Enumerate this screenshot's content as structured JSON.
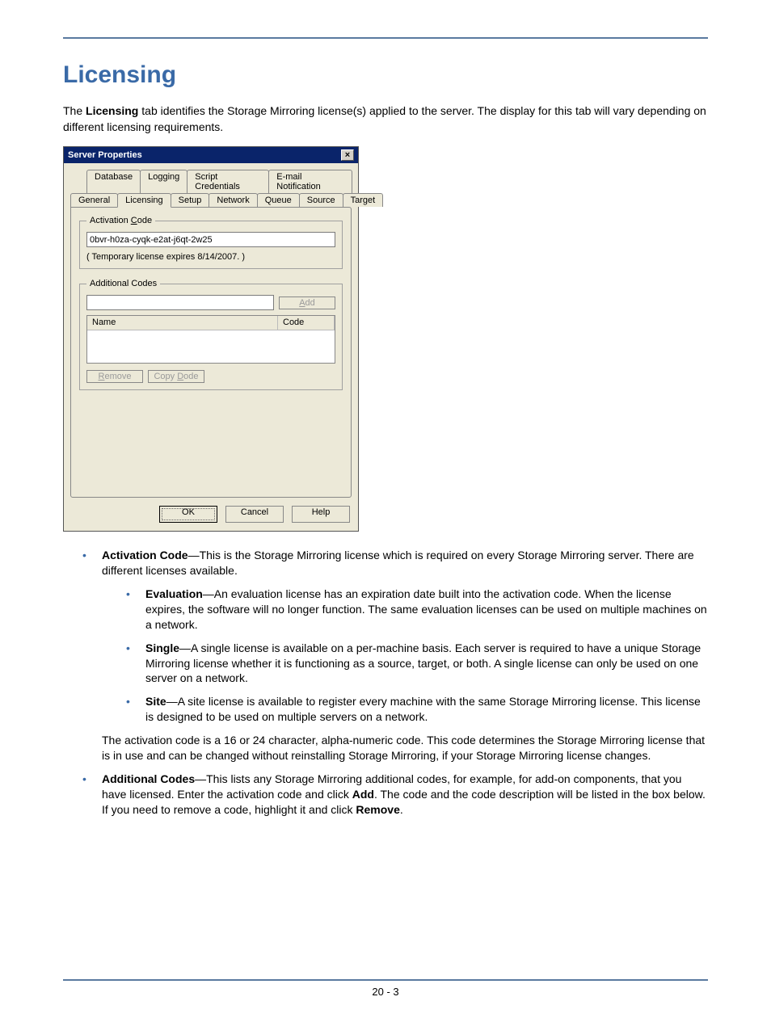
{
  "heading": "Licensing",
  "intro_pre": "The ",
  "intro_bold": "Licensing",
  "intro_post": " tab identifies the Storage Mirroring license(s) applied to the server. The display for this tab will vary depending on different licensing requirements.",
  "dialog": {
    "title": "Server Properties",
    "close": "×",
    "tabs_row1": [
      "Database",
      "Logging",
      "Script Credentials",
      "E-mail Notification"
    ],
    "tabs_row2": [
      "General",
      "Licensing",
      "Setup",
      "Network",
      "Queue",
      "Source",
      "Target"
    ],
    "activation": {
      "legend_pre": "Activation ",
      "legend_key": "C",
      "legend_post": "ode",
      "value": "0bvr-h0za-cyqk-e2at-j6qt-2w25",
      "hint": "( Temporary license expires 8/14/2007. )"
    },
    "additional": {
      "legend": "Additional Codes",
      "add_label_key": "A",
      "add_label_rest": "dd",
      "col_name": "Name",
      "col_code": "Code",
      "remove_key": "R",
      "remove_rest": "emove",
      "copy_pre": "Copy ",
      "copy_key": "D",
      "copy_rest": "ode"
    },
    "buttons": {
      "ok": "OK",
      "cancel": "Cancel",
      "help": "Help"
    }
  },
  "bullets": {
    "b1_label": "Activation Code",
    "b1_text": "—This is the Storage Mirroring license which is required on every Storage Mirroring server. There are different licenses available.",
    "b1a_label": "Evaluation",
    "b1a_text": "—An evaluation license has an expiration date built into the activation code. When the license expires, the software will no longer function. The same evaluation licenses can be used on multiple machines on a network.",
    "b1b_label": "Single",
    "b1b_text": "—A single license is available on a per-machine basis. Each server is required to have a unique Storage Mirroring license whether it is functioning as a source, target, or both. A single license can only be used on one server on a network.",
    "b1c_label": "Site",
    "b1c_text": "—A site license is available to register every machine with the same Storage Mirroring license. This license is designed to be used on multiple servers on a network.",
    "b1_after": "The activation code is a 16 or 24 character, alpha-numeric code. This code determines the Storage Mirroring license that is in use and can be changed without reinstalling Storage Mirroring, if your Storage Mirroring license changes.",
    "b2_label": "Additional Codes",
    "b2_text_a": "—This lists any Storage Mirroring additional codes, for example, for add-on components, that you have licensed. Enter the activation code and click ",
    "b2_add": "Add",
    "b2_text_b": ". The code and the code description will be listed in the box below. If you need to remove a code, highlight it and click ",
    "b2_remove": "Remove",
    "b2_text_c": "."
  },
  "footer": "20 - 3"
}
